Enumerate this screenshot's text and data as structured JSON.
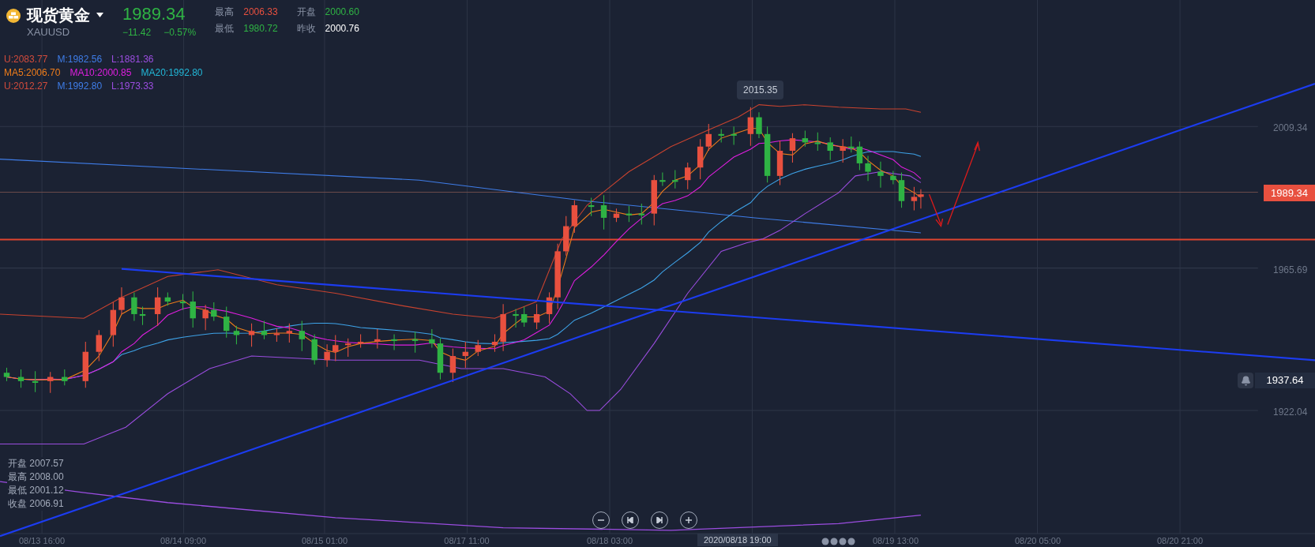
{
  "header": {
    "name": "现货黄金",
    "symbol": "XAUUSD",
    "price": "1989.34",
    "change": "−11.42",
    "change_pct": "−0.57%",
    "stats": [
      {
        "label": "最高",
        "value": "2006.33",
        "color": "#e8503f"
      },
      {
        "label": "开盘",
        "value": "2000.60",
        "color": "#2fb344"
      },
      {
        "label": "最低",
        "value": "1980.72",
        "color": "#2fb344"
      },
      {
        "label": "昨收",
        "value": "2000.76",
        "color": "#ffffff"
      }
    ]
  },
  "indicators": [
    [
      {
        "text": "U:2083.77",
        "color": "#d24b3c"
      },
      {
        "text": "M:1982.56",
        "color": "#3f7de8"
      },
      {
        "text": "L:1881.36",
        "color": "#9b4de0"
      }
    ],
    [
      {
        "text": "MA5:2006.70",
        "color": "#f07d1a"
      },
      {
        "text": "MA10:2000.85",
        "color": "#e01ee0"
      },
      {
        "text": "MA20:1992.80",
        "color": "#22b8d8"
      }
    ],
    [
      {
        "text": "U:2012.27",
        "color": "#d24b3c"
      },
      {
        "text": "M:1992.80",
        "color": "#3f7de8"
      },
      {
        "text": "L:1973.33",
        "color": "#9b4de0"
      }
    ]
  ],
  "ohlc": [
    {
      "label": "开盘",
      "value": "2007.57"
    },
    {
      "label": "最高",
      "value": "2008.00"
    },
    {
      "label": "最低",
      "value": "2001.12"
    },
    {
      "label": "收盘",
      "value": "2006.91"
    }
  ],
  "peak_label": "2015.35",
  "price_axis": [
    "2009.34",
    "1965.69",
    "1922.04"
  ],
  "last_price_tag": "1989.34",
  "alert": {
    "price": "1937.64"
  },
  "time_axis": [
    "08/13 16:00",
    "08/14 09:00",
    "08/15 01:00",
    "08/17 11:00",
    "08/18 03:00",
    "08/19 13:00",
    "08/20 05:00",
    "08/20 21:00"
  ],
  "crosshair_time": "2020/08/18 19:00"
}
